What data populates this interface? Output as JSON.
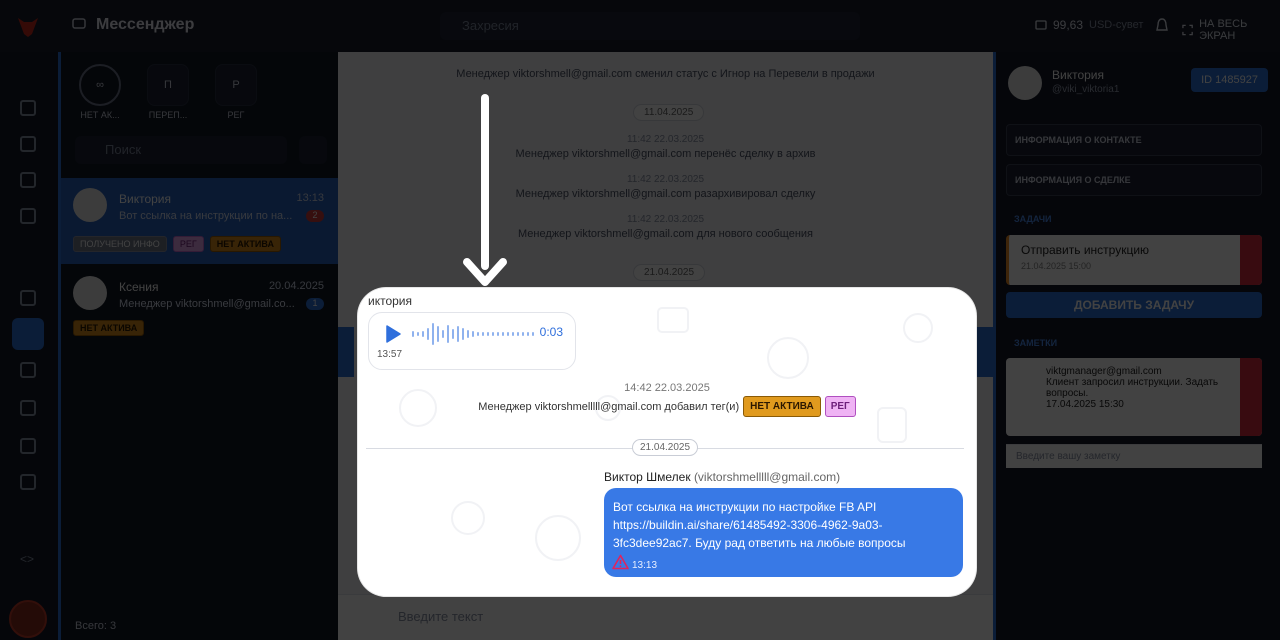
{
  "app": {
    "title": "Мессенджер",
    "search_placeholder": "Захресия",
    "balance_value": "99,63",
    "balance_currency": "USD-сувет",
    "fullscreen_label": "НА ВЕСЬ ЭКРАН"
  },
  "chat_list": {
    "filters": [
      {
        "icon": "none-icon",
        "label": "НЕТ АК..."
      },
      {
        "icon": "a-icon",
        "label": "ПЕРЕП..."
      },
      {
        "icon": "p-icon",
        "label": "РЕГ"
      }
    ],
    "search_placeholder": "Поиск",
    "items": [
      {
        "name": "Виктория",
        "time": "13:13",
        "preview": "Вот ссылка на инструкции по на...",
        "unread": "2",
        "tags": [
          "ПОЛУЧЕНО ИНФО",
          "РЕГ",
          "НЕТ АКТИВА"
        ]
      },
      {
        "name": "Ксения",
        "time": "20.04.2025",
        "preview": "Менеджер viktorshmell@gmail.co...",
        "unread": "1",
        "tags": [
          "НЕТ АКТИВА"
        ]
      }
    ],
    "total": "Всего: 3"
  },
  "chat": {
    "sys1": "Менеджер viktorshmell@gmail.com сменил статус с Игнор на Перевели в продажи",
    "date1": "11.04.2025",
    "t2": "11:42 22.03.2025",
    "sys2": "Менеджер viktorshmell@gmail.com перенёс сделку в архив",
    "t3": "11:42 22.03.2025",
    "sys3": "Менеджер viktorshmell@gmail.com разархивировал сделку",
    "t4": "11:42 22.03.2025",
    "sys4": "Менеджер viktorshmell@gmail.com для нового сообщения",
    "date2": "21.04.2025",
    "input_placeholder": "Введите текст"
  },
  "contact": {
    "name": "Виктория",
    "handle": "@viki_viktoria1",
    "id_button": "ID 1485927",
    "sections": {
      "contact_info": "ИНФОРМАЦИЯ О КОНТАКТЕ",
      "deal_info": "ИНФОРМАЦИЯ О СДЕЛКЕ",
      "tasks": "ЗАДАЧИ",
      "notes": "ЗАМЕТКИ"
    },
    "task": {
      "title": "Отправить инструкцию",
      "date": "21.04.2025 15:00"
    },
    "add_task": "ДОБАВИТЬ ЗАДАЧУ",
    "note": {
      "author": "viktgmanager@gmail.com",
      "text": "Клиент запросил инструкции. Задать вопросы.",
      "date": "17.04.2025 15:30"
    },
    "note_placeholder": "Введите вашу заметку"
  },
  "zoom": {
    "sender": "иктория",
    "voice_duration": "0:03",
    "voice_time": "13:57",
    "sys_time": "14:42 22.03.2025",
    "sys_text": "Менеджер viktorshmelllll@gmail.com добавил тег(и)",
    "tags": [
      "НЕТ АКТИВА",
      "РЕГ"
    ],
    "date": "21.04.2025",
    "out_sender_name": "Виктор Шмелек",
    "out_sender_email": "(viktorshmelllll@gmail.com)",
    "out_text": "Вот ссылка на инструкции по настройке FB API https://buildin.ai/share/61485492-3306-4962-9a03-3fc3dee92ac7. Буду рад ответить на любые вопросы",
    "out_time": "13:13"
  },
  "colors": {
    "accent": "#2b6fd6",
    "bubble": "#3879e6",
    "tag_orange": "#e09a1e",
    "tag_pink": "#efb3f4",
    "warn_red": "#e0245e"
  }
}
